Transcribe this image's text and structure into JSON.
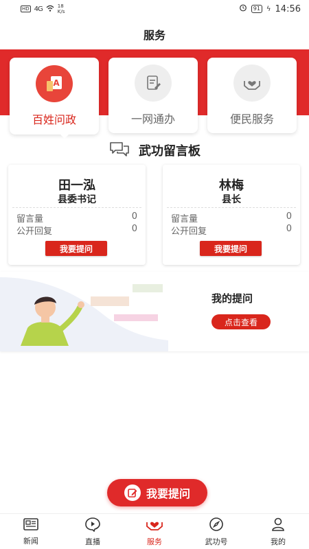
{
  "status_bar": {
    "hd": "HD",
    "signal": "4G",
    "speed_value": "18",
    "speed_unit": "K/s",
    "battery": "91",
    "time": "14:56"
  },
  "header": {
    "title": "服务"
  },
  "services": [
    {
      "label": "百姓问政",
      "icon": "document-a-icon",
      "active": true
    },
    {
      "label": "一网通办",
      "icon": "form-pen-icon",
      "active": false
    },
    {
      "label": "便民服务",
      "icon": "heart-hands-icon",
      "active": false
    }
  ],
  "board": {
    "title": "武功留言板",
    "icon": "chat-bubbles-icon"
  },
  "officials": [
    {
      "name": "田一泓",
      "role": "县委书记",
      "msg_label": "留言量",
      "msg_count": "0",
      "reply_label": "公开回复",
      "reply_count": "0",
      "ask_label": "我要提问"
    },
    {
      "name": "林梅",
      "role": "县长",
      "msg_label": "留言量",
      "msg_count": "0",
      "reply_label": "公开回复",
      "reply_count": "0",
      "ask_label": "我要提问"
    }
  ],
  "my_questions": {
    "title": "我的提问",
    "view_label": "点击查看"
  },
  "float_ask": {
    "label": "我要提问",
    "icon": "edit-icon"
  },
  "tabs": [
    {
      "label": "新闻",
      "icon": "news-icon",
      "active": false
    },
    {
      "label": "直播",
      "icon": "play-icon",
      "active": false
    },
    {
      "label": "服务",
      "icon": "heart-hands-icon",
      "active": true
    },
    {
      "label": "武功号",
      "icon": "compass-icon",
      "active": false
    },
    {
      "label": "我的",
      "icon": "person-icon",
      "active": false
    }
  ],
  "colors": {
    "accent": "#d9261c",
    "band": "#e02a2a"
  }
}
